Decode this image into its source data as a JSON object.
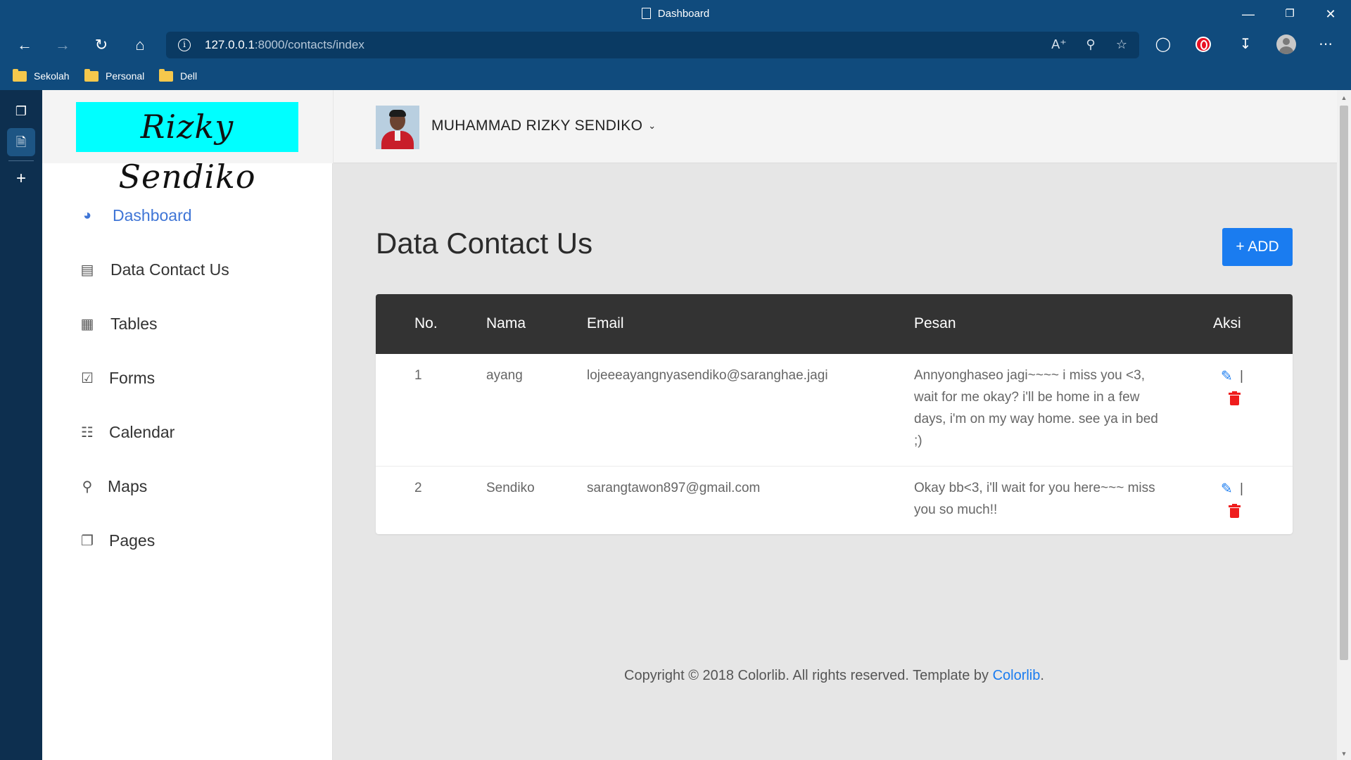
{
  "browser": {
    "tab_title": "Dashboard",
    "url_host": "127.0.0.1",
    "url_rest": ":8000/contacts/index",
    "bookmarks": [
      {
        "label": "Sekolah"
      },
      {
        "label": "Personal"
      },
      {
        "label": "Dell"
      }
    ]
  },
  "sidebar": {
    "logo_text": "Rizky Sendiko",
    "items": [
      {
        "label": "Dashboard",
        "icon": "dashboard-icon",
        "active": true
      },
      {
        "label": "Data Contact Us",
        "icon": "bar-chart-icon"
      },
      {
        "label": "Tables",
        "icon": "table-icon"
      },
      {
        "label": "Forms",
        "icon": "checkbox-icon"
      },
      {
        "label": "Calendar",
        "icon": "calendar-icon"
      },
      {
        "label": "Maps",
        "icon": "map-marker-icon"
      },
      {
        "label": "Pages",
        "icon": "pages-icon"
      }
    ]
  },
  "header": {
    "user_name": "MUHAMMAD RIZKY SENDIKO"
  },
  "main": {
    "title": "Data Contact Us",
    "add_label": "+ ADD",
    "columns": [
      "No.",
      "Nama",
      "Email",
      "Pesan",
      "Aksi"
    ],
    "rows": [
      {
        "no": "1",
        "nama": "ayang",
        "email": "lojeeeayangnyasendiko@saranghae.jagi",
        "pesan": "Annyonghaseo jagi~~~~ i miss you <3, wait for me okay? i'll be home in a few days, i'm on my way home. see ya in bed ;)"
      },
      {
        "no": "2",
        "nama": "Sendiko",
        "email": "sarangtawon897@gmail.com",
        "pesan": "Okay bb<3, i'll wait for you here~~~ miss you so much!!"
      }
    ],
    "action_separator": "|"
  },
  "footer": {
    "text": "Copyright © 2018 Colorlib. All rights reserved. Template by ",
    "link": "Colorlib",
    "end": "."
  },
  "colors": {
    "brand_bg": "#00ffff",
    "accent": "#1a7cf0",
    "delete": "#ef1c1c",
    "table_header": "#333333",
    "browser_frame": "#104b7d"
  }
}
